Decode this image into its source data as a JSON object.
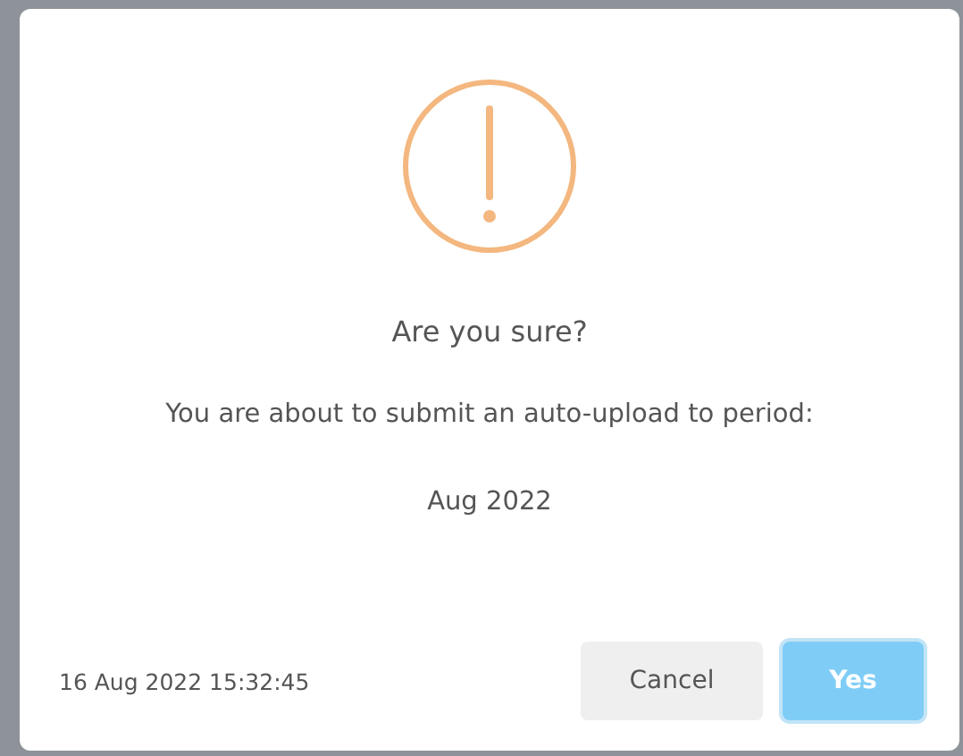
{
  "dialog": {
    "title": "Are you sure?",
    "message": "You are about to submit an auto-upload to period:",
    "period": "Aug 2022",
    "timestamp": "16 Aug 2022 15:32:45",
    "buttons": [
      {
        "label": "Cancel",
        "kind": "secondary"
      },
      {
        "label": "Yes",
        "kind": "primary"
      }
    ]
  }
}
